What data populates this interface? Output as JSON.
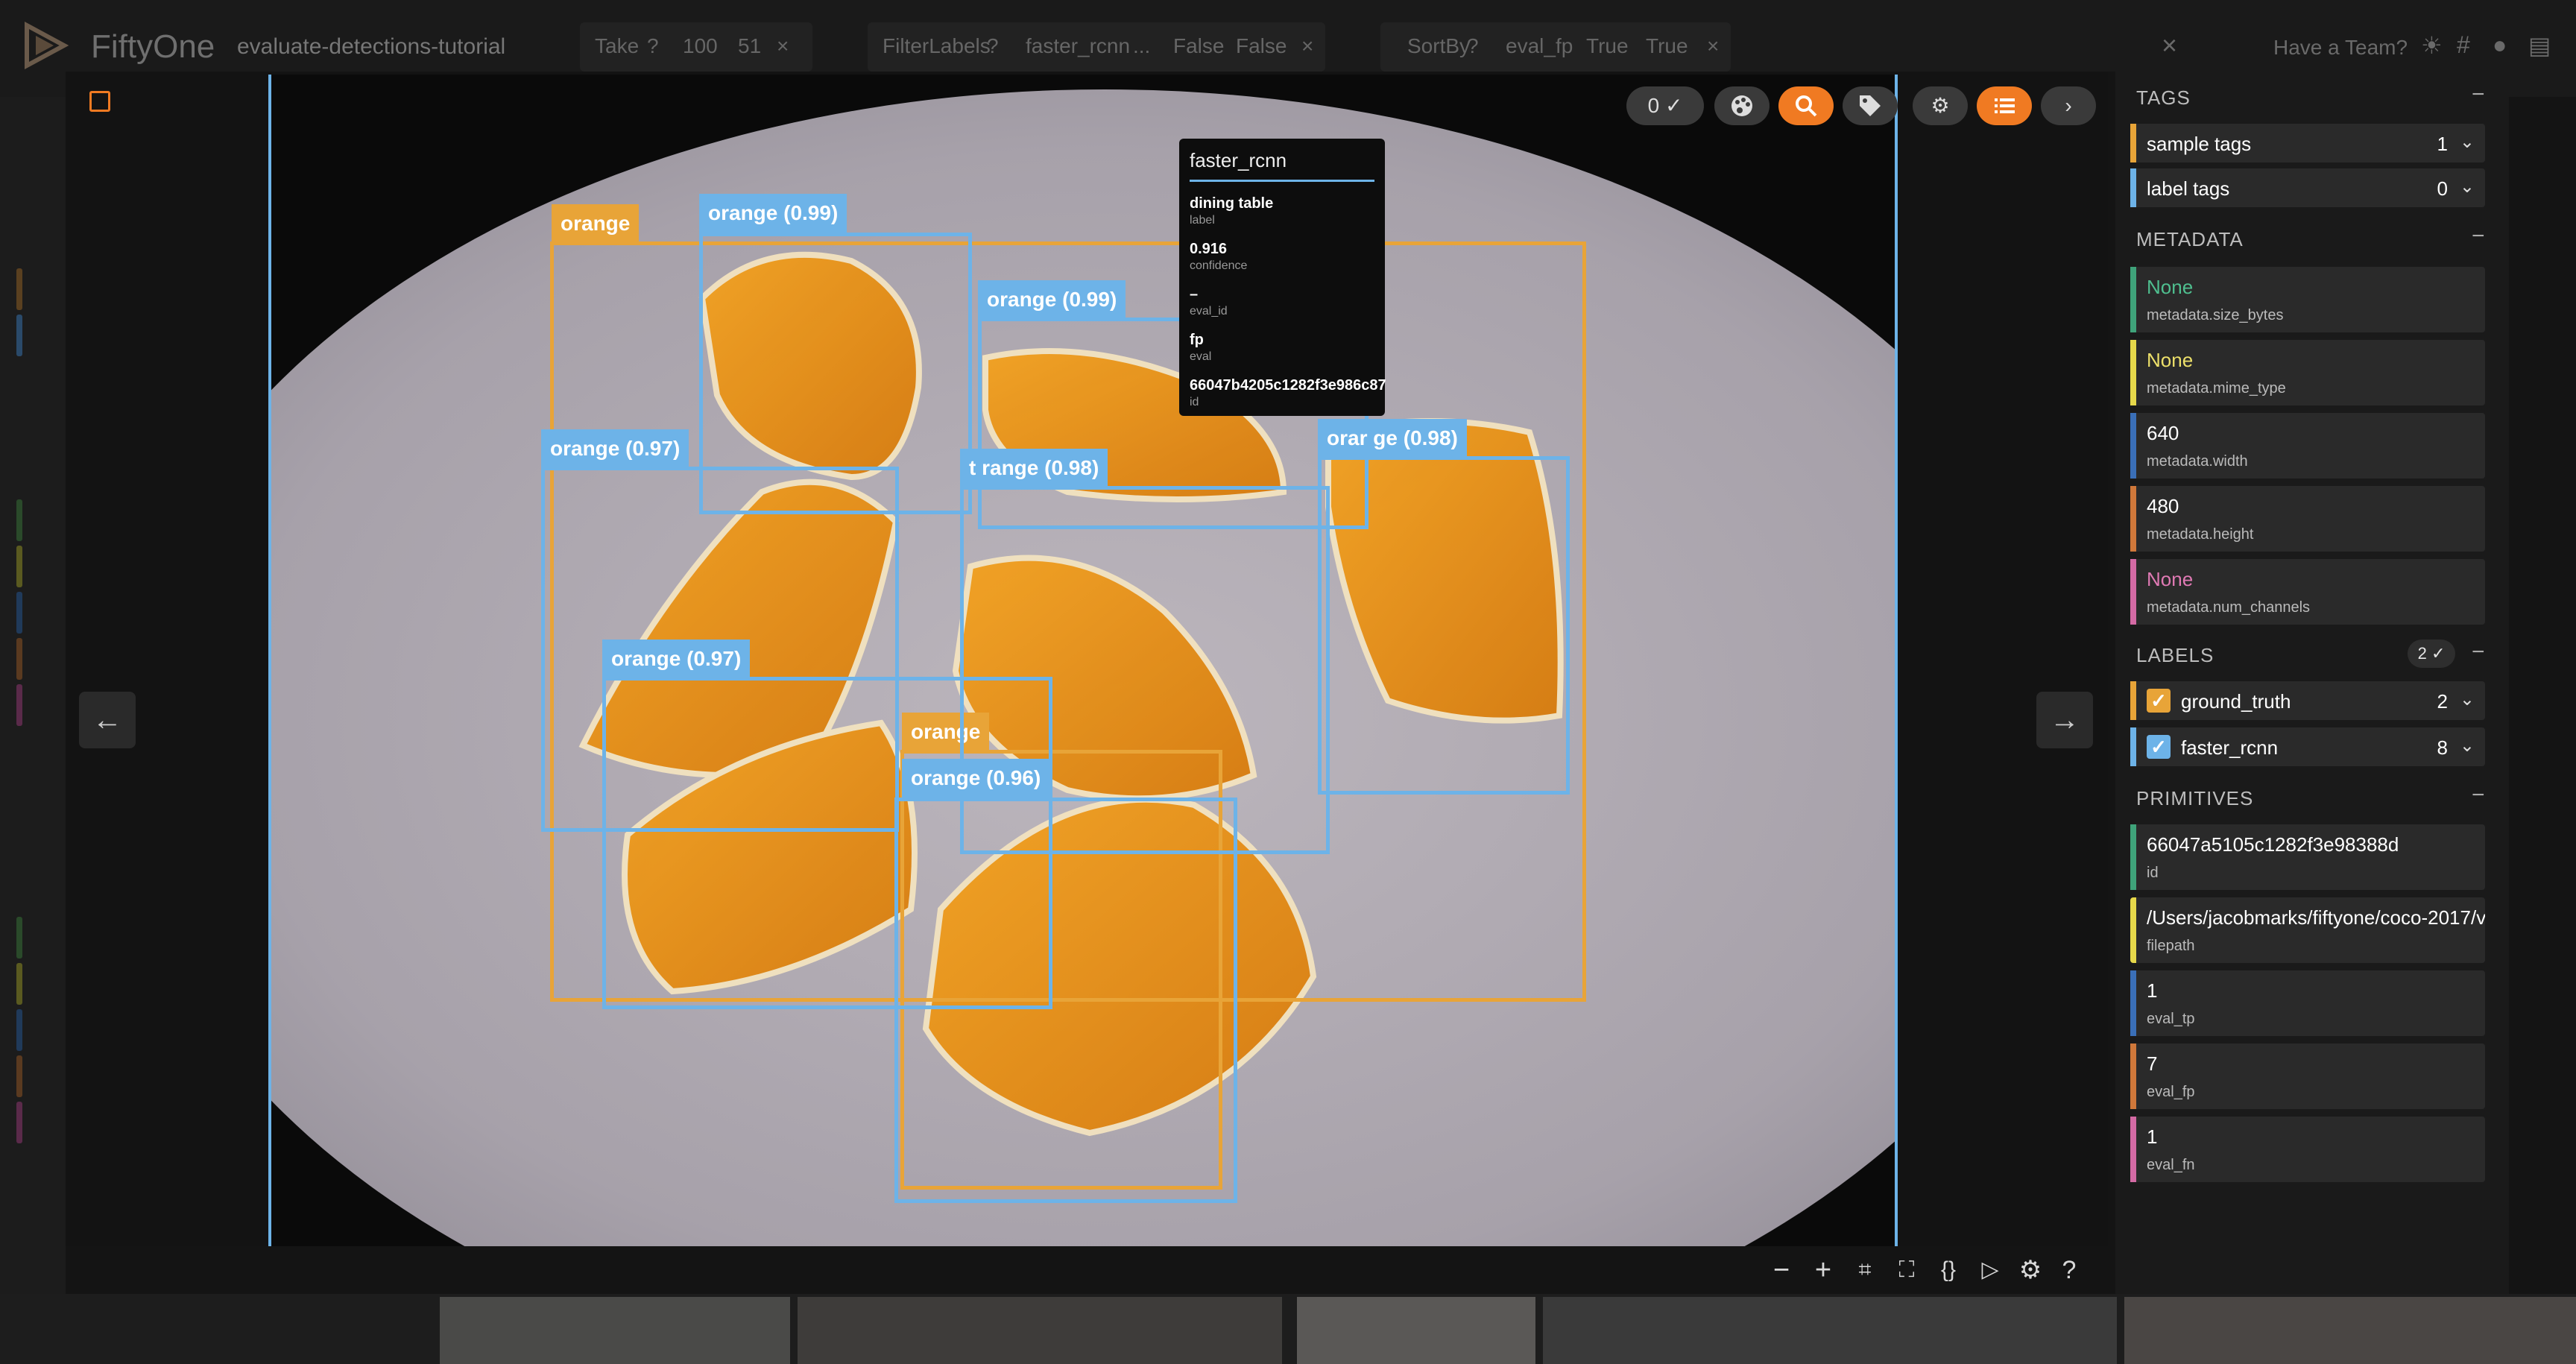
{
  "app": {
    "name": "FiftyOne",
    "dataset": "evaluate-detections-tutorial",
    "team_link": "Have a Team?"
  },
  "view_stages": [
    {
      "name": "Take",
      "params": [
        "100",
        "51"
      ]
    },
    {
      "name": "FilterLabels",
      "params": [
        "faster_rcnn",
        "...",
        "False",
        "False"
      ]
    },
    {
      "name": "SortBy",
      "params": [
        "eval_fp",
        "True",
        "True"
      ]
    }
  ],
  "controls": {
    "selected_count": "0",
    "select_check": "✓"
  },
  "detections": [
    {
      "label": "orange",
      "source": "ground_truth"
    },
    {
      "label": "orange (0.99)",
      "source": "faster_rcnn"
    },
    {
      "label": "orange (0.99)",
      "source": "faster_rcnn"
    },
    {
      "label": "orange (0.97)",
      "source": "faster_rcnn"
    },
    {
      "label": "t range (0.98)",
      "source": "faster_rcnn"
    },
    {
      "label": "orar ge (0.98)",
      "source": "faster_rcnn"
    },
    {
      "label": "orange (0.97)",
      "source": "faster_rcnn"
    },
    {
      "label": "orange",
      "source": "ground_truth"
    },
    {
      "label": "orange (0.96)",
      "source": "faster_rcnn"
    }
  ],
  "tooltip": {
    "title": "faster_rcnn",
    "fields": [
      {
        "value": "dining table",
        "key": "label"
      },
      {
        "value": "0.916",
        "key": "confidence"
      },
      {
        "value": "–",
        "key": "eval_id"
      },
      {
        "value": "fp",
        "key": "eval"
      },
      {
        "value": "66047b4205c1282f3e986c87",
        "key": "id"
      }
    ]
  },
  "sidebar": {
    "tags": {
      "title": "TAGS",
      "items": [
        {
          "label": "sample tags",
          "count": "1",
          "color": "#e8a438"
        },
        {
          "label": "label tags",
          "count": "0",
          "color": "#6db3e8"
        }
      ]
    },
    "metadata": {
      "title": "METADATA",
      "items": [
        {
          "value": "None",
          "key": "metadata.size_bytes",
          "color": "#3fa37a",
          "value_color": "#4fbf8f"
        },
        {
          "value": "None",
          "key": "metadata.mime_type",
          "color": "#e6d84a",
          "value_color": "#ede06a"
        },
        {
          "value": "640",
          "key": "metadata.width",
          "color": "#3a6fb8",
          "value_color": "#ffffff"
        },
        {
          "value": "480",
          "key": "metadata.height",
          "color": "#d0783a",
          "value_color": "#ffffff"
        },
        {
          "value": "None",
          "key": "metadata.num_channels",
          "color": "#d46aa4",
          "value_color": "#e07ab4"
        }
      ]
    },
    "labels": {
      "title": "LABELS",
      "badge": "2",
      "items": [
        {
          "label": "ground_truth",
          "count": "2",
          "color": "#e8a438"
        },
        {
          "label": "faster_rcnn",
          "count": "8",
          "color": "#6db3e8"
        }
      ]
    },
    "primitives": {
      "title": "PRIMITIVES",
      "items": [
        {
          "value": "66047a5105c1282f3e98388d",
          "key": "id",
          "color": "#3fa37a"
        },
        {
          "value": "/Users/jacobmarks/fiftyone/coco-2017/v...",
          "key": "filepath",
          "color": "#e6d84a"
        },
        {
          "value": "1",
          "key": "eval_tp",
          "color": "#3a6fb8"
        },
        {
          "value": "7",
          "key": "eval_fp",
          "color": "#d0783a"
        },
        {
          "value": "1",
          "key": "eval_fn",
          "color": "#d46aa4"
        }
      ]
    }
  },
  "colors": {
    "ground_truth": "#e8a438",
    "faster_rcnn": "#6db3e8",
    "accent": "#f07a22"
  }
}
